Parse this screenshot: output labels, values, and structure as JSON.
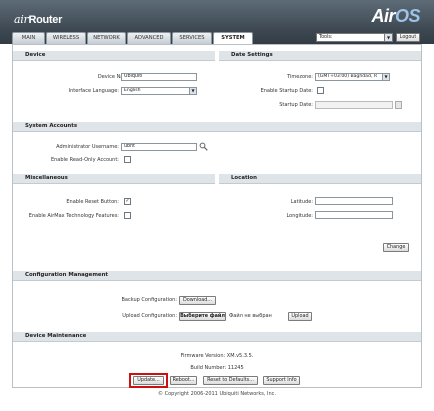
{
  "header": {
    "brand_prefix": "air",
    "brand_product": "Router",
    "brand_os_a": "Air",
    "brand_os_b": "OS"
  },
  "tabs": [
    {
      "label": "MAIN"
    },
    {
      "label": "WIRELESS"
    },
    {
      "label": "NETWORK"
    },
    {
      "label": "ADVANCED"
    },
    {
      "label": "SERVICES"
    },
    {
      "label": "SYSTEM",
      "active": true
    }
  ],
  "toolbar": {
    "tools_value": "Tools:",
    "logout_label": "Logout"
  },
  "device": {
    "heading": "Device",
    "name_label": "Device Name:",
    "name_value": "Ubiquiti",
    "language_label": "Interface Language:",
    "language_value": "English"
  },
  "date": {
    "heading": "Date Settings",
    "timezone_label": "Timezone:",
    "timezone_value": "(GMT+03:00) Baghdad, R",
    "startup_label": "Enable Startup Date:",
    "startup_date_label": "Startup Date:"
  },
  "accounts": {
    "heading": "System Accounts",
    "admin_label": "Administrator Username:",
    "admin_value": "ubnt",
    "readonly_label": "Enable Read-Only Account:"
  },
  "misc": {
    "heading": "Miscellaneous",
    "reset_label": "Enable Reset Button:",
    "reset_checked": "✓",
    "airmax_label": "Enable AirMax Technology Features:"
  },
  "location": {
    "heading": "Location",
    "lat_label": "Latitude:",
    "lon_label": "Longitude:"
  },
  "change_label": "Change",
  "config": {
    "heading": "Configuration Management",
    "backup_label": "Backup Configuration:",
    "download_label": "Download...",
    "upload_label": "Upload Configuration:",
    "choose_file_label": "Выберите файл",
    "no_file_text": "Файл не выбран",
    "upload_button": "Upload"
  },
  "maintenance": {
    "heading": "Device Maintenance",
    "firmware_text": "Firmware Version: XM.v5.3.5.",
    "build_text": "Build Number: 11245",
    "update_label": "Update...",
    "reboot_label": "Reboot...",
    "reset_defaults_label": "Reset to Defaults...",
    "support_label": "Support Info"
  },
  "footer": {
    "copyright": "© Copyright 2006-2011 Ubiquiti Networks, Inc."
  },
  "colors": {
    "highlight": "#cc1111",
    "header_bg": "#3c4750",
    "section_bg": "#dfe4e8"
  }
}
